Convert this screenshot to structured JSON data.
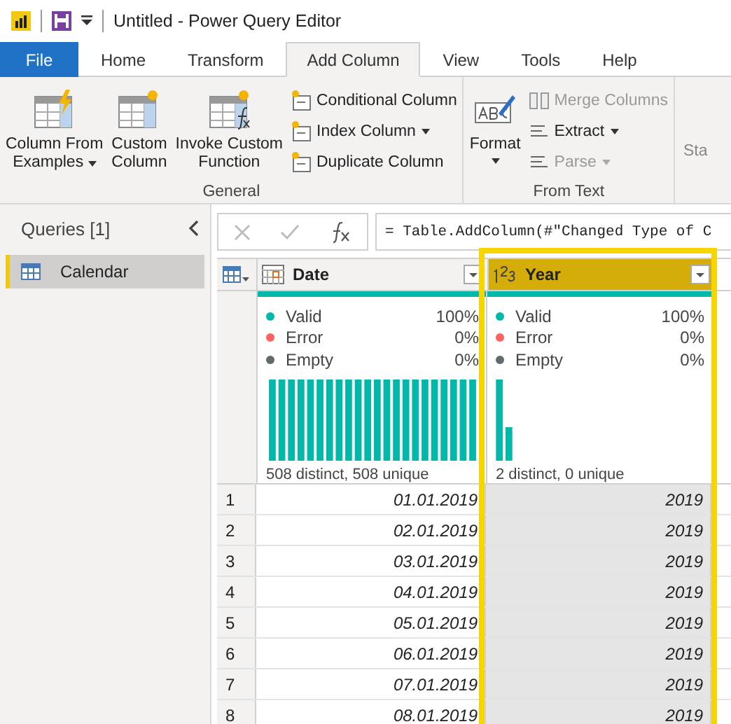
{
  "window": {
    "title": "Untitled - Power Query Editor"
  },
  "tabs": [
    {
      "label": "File",
      "kind": "file",
      "selected": false
    },
    {
      "label": "Home",
      "kind": "tab",
      "selected": false
    },
    {
      "label": "Transform",
      "kind": "tab",
      "selected": false
    },
    {
      "label": "Add Column",
      "kind": "tab",
      "selected": true
    },
    {
      "label": "View",
      "kind": "tab",
      "selected": false
    },
    {
      "label": "Tools",
      "kind": "tab",
      "selected": false
    },
    {
      "label": "Help",
      "kind": "tab",
      "selected": false
    }
  ],
  "ribbon": {
    "groups": [
      {
        "label": "General",
        "items": [
          {
            "kind": "large",
            "lines": [
              "Column From",
              "Examples"
            ],
            "dropdown": true,
            "disabled": false
          },
          {
            "kind": "large",
            "lines": [
              "Custom",
              "Column"
            ],
            "dropdown": false,
            "disabled": false
          },
          {
            "kind": "large",
            "lines": [
              "Invoke Custom",
              "Function"
            ],
            "dropdown": false,
            "disabled": false
          },
          {
            "kind": "stack",
            "buttons": [
              {
                "label": "Conditional Column",
                "dropdown": false,
                "disabled": false
              },
              {
                "label": "Index Column",
                "dropdown": true,
                "disabled": false
              },
              {
                "label": "Duplicate Column",
                "dropdown": false,
                "disabled": false
              }
            ]
          }
        ]
      },
      {
        "label": "From Text",
        "items": [
          {
            "kind": "large",
            "lines": [
              "Format"
            ],
            "dropdown": true,
            "disabled": false
          },
          {
            "kind": "stack",
            "buttons": [
              {
                "label": "Merge Columns",
                "dropdown": false,
                "disabled": true
              },
              {
                "label": "Extract",
                "dropdown": true,
                "disabled": false
              },
              {
                "label": "Parse",
                "dropdown": true,
                "disabled": true
              }
            ]
          }
        ]
      }
    ],
    "cut_label": "Sta"
  },
  "queries": {
    "title": "Queries [1]",
    "items": [
      {
        "label": "Calendar",
        "selected": true
      }
    ]
  },
  "formula_bar": {
    "text": "= Table.AddColumn(#\"Changed Type of C"
  },
  "columns": [
    {
      "name": "Date",
      "selected": false,
      "stats": [
        {
          "label": "Valid",
          "value": "100%",
          "color": "#01b8aa"
        },
        {
          "label": "Error",
          "value": "0%",
          "color": "#fd625e"
        },
        {
          "label": "Empty",
          "value": "0%",
          "color": "#5f6b6d"
        }
      ],
      "summary": "508 distinct, 508 unique"
    },
    {
      "name": "Year",
      "selected": true,
      "stats": [
        {
          "label": "Valid",
          "value": "100%",
          "color": "#01b8aa"
        },
        {
          "label": "Error",
          "value": "0%",
          "color": "#fd625e"
        },
        {
          "label": "Empty",
          "value": "0%",
          "color": "#5f6b6d"
        }
      ],
      "summary": "2 distinct, 0 unique"
    }
  ],
  "rows": [
    {
      "index": "1",
      "cells": [
        "01.01.2019",
        "2019"
      ]
    },
    {
      "index": "2",
      "cells": [
        "02.01.2019",
        "2019"
      ]
    },
    {
      "index": "3",
      "cells": [
        "03.01.2019",
        "2019"
      ]
    },
    {
      "index": "4",
      "cells": [
        "04.01.2019",
        "2019"
      ]
    },
    {
      "index": "5",
      "cells": [
        "05.01.2019",
        "2019"
      ]
    },
    {
      "index": "6",
      "cells": [
        "06.01.2019",
        "2019"
      ]
    },
    {
      "index": "7",
      "cells": [
        "07.01.2019",
        "2019"
      ]
    },
    {
      "index": "8",
      "cells": [
        "08.01.2019",
        "2019"
      ]
    }
  ]
}
